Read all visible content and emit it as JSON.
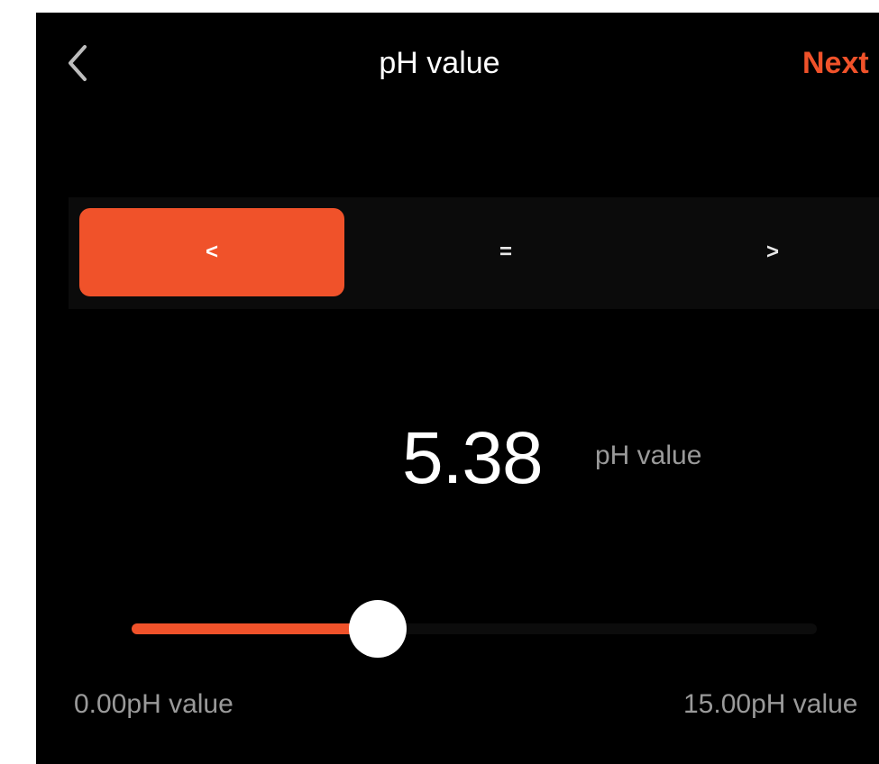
{
  "header": {
    "back_icon": "chevron-left-icon",
    "title": "pH value",
    "next_label": "Next",
    "accent_color": "#f0522a"
  },
  "comparator": {
    "options": [
      {
        "label": "<",
        "selected": true
      },
      {
        "label": "=",
        "selected": false
      },
      {
        "label": ">",
        "selected": false
      }
    ]
  },
  "reading": {
    "value": "5.38",
    "unit": "pH value"
  },
  "slider": {
    "min": 0.0,
    "max": 15.0,
    "value": 5.38,
    "min_label": "0.00pH value",
    "max_label": "15.00pH value"
  }
}
